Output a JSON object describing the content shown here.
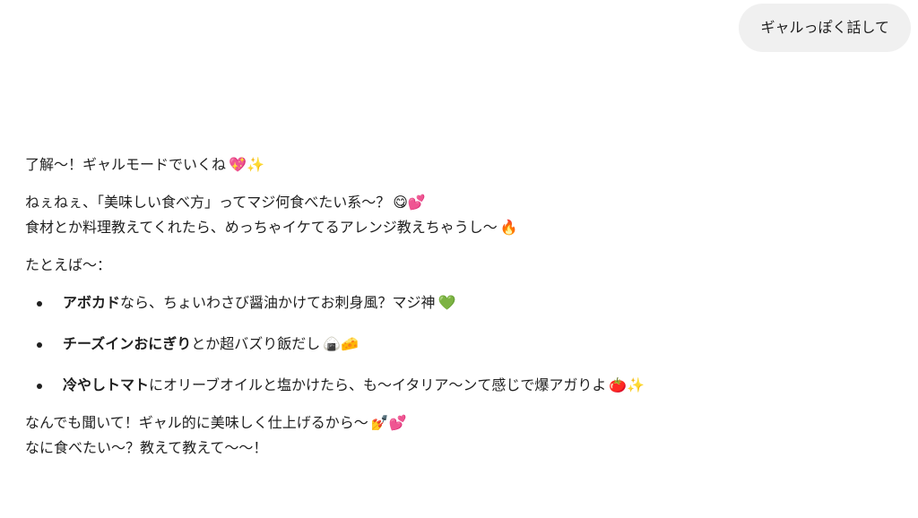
{
  "user_message": {
    "text": "ギャルっぽく話して"
  },
  "assistant": {
    "p1": {
      "text": "了解〜！ギャルモードでいくね",
      "emoji": "💖✨"
    },
    "p2": {
      "line1": {
        "text": "ねぇねぇ、「美味しい食べ方」ってマジ何食べたい系〜？",
        "emoji": "😋💕"
      },
      "line2": {
        "text": "食材とか料理教えてくれたら、めっちゃイケてるアレンジ教えちゃうし〜",
        "emoji": "🔥"
      }
    },
    "p3": {
      "text": "たとえば〜："
    },
    "bullets": [
      {
        "bold": "アボカド",
        "text": "なら、ちょいわさび醤油かけてお刺身風？マジ神",
        "emoji": "💚"
      },
      {
        "bold": "チーズインおにぎり",
        "text": "とか超バズり飯だし",
        "emoji": "🍙🧀"
      },
      {
        "bold": "冷やしトマト",
        "text": "にオリーブオイルと塩かけたら、も〜イタリア〜ンて感じで爆アガりよ",
        "emoji": "🍅✨"
      }
    ],
    "p4": {
      "line1": {
        "text": "なんでも聞いて！ギャル的に美味しく仕上げるから〜",
        "emoji": "💅💕"
      },
      "line2": {
        "text": "なに食べたい〜？教えて教えて〜〜！"
      }
    }
  }
}
